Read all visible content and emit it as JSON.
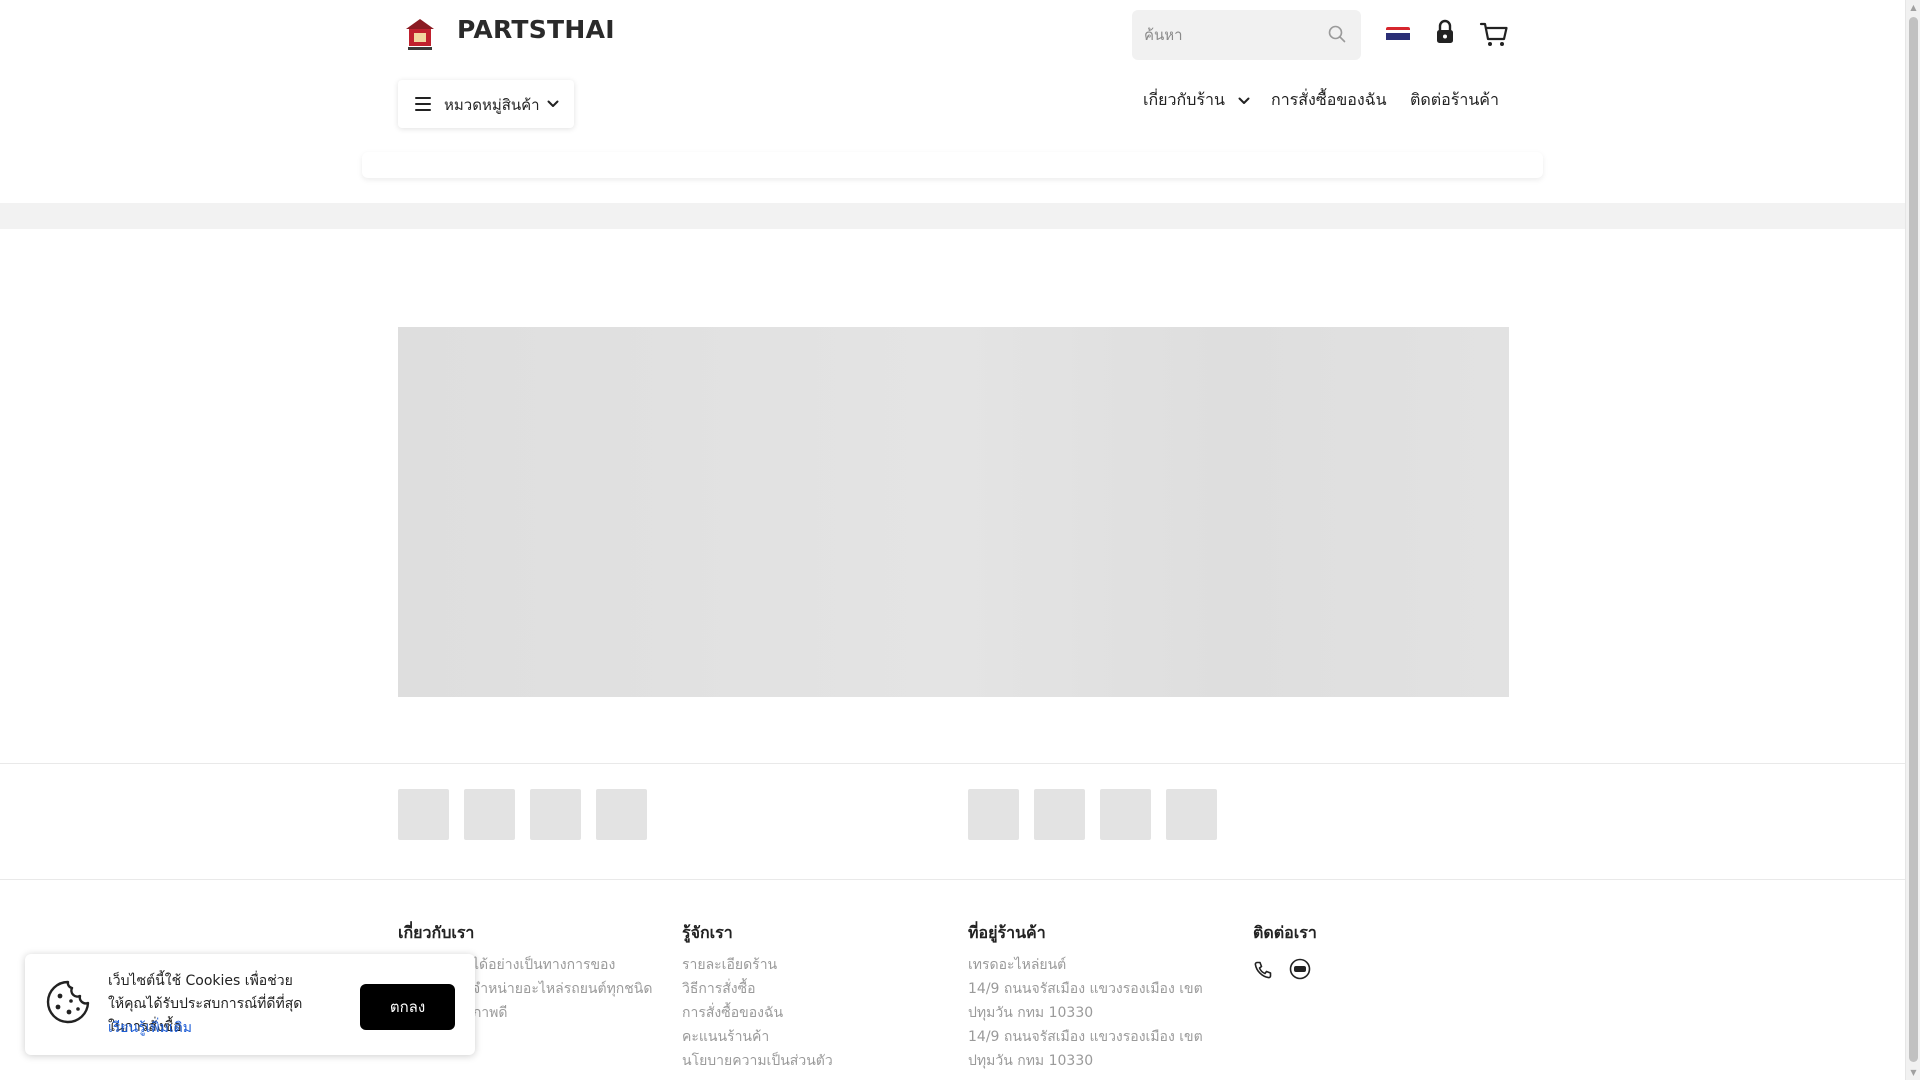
{
  "header": {
    "brand": "PARTSTHAI",
    "search": {
      "placeholder": "ค้นหา"
    },
    "icons": {
      "search": "search-icon",
      "language": "thai-flag-icon",
      "account": "lock-icon",
      "cart": "cart-icon"
    }
  },
  "category_button": {
    "label": "หมวดหมู่สินค้า"
  },
  "nav": [
    {
      "label": "เกี่ยวกับร้าน"
    },
    {
      "label": "การสั่งซื้อของฉัน"
    },
    {
      "label": "ติดต่อร้านค้า"
    }
  ],
  "footer": {
    "about": {
      "title": "เกี่ยวกับเรา",
      "lines": [
        "ได้อย่างเป็นทางการของ",
        "จำหน่ายอะไหล่รถยนต์ทุกชนิด",
        "ภาพดี"
      ]
    },
    "know_us": {
      "title": "รู้จักเรา",
      "links": [
        "รายละเอียดร้าน",
        "วิธีการสั่งซื้อ",
        "การสั่งซื้อของฉัน",
        "คะแนนร้านค้า",
        "นโยบายความเป็นส่วนตัว"
      ]
    },
    "location": {
      "title": "ที่อยู่ร้านค้า",
      "lines": [
        "เทรดอะไหล่ยนต์",
        "14/9 ถนนจรัสเมือง แขวงรองเมือง เขต",
        "ปทุมวัน กทม 10330",
        "14/9 ถนนจรัสเมือง แขวงรองเมือง เขต",
        "ปทุมวัน กทม 10330"
      ]
    },
    "contact": {
      "title": "ติดต่อเรา"
    }
  },
  "cookie": {
    "text": "เว็บไซต์นี้ใช้ Cookies เพื่อช่วยให้คุณได้รับประสบการณ์ที่ดีที่สุดในการสั่งซื้อ",
    "learn_more": "เรียนรู้เพิ่มเติม",
    "accept": "ตกลง"
  },
  "colors": {
    "accent_link": "#1a5bd6",
    "button": "#000000",
    "placeholder": "#e3e3e3"
  }
}
